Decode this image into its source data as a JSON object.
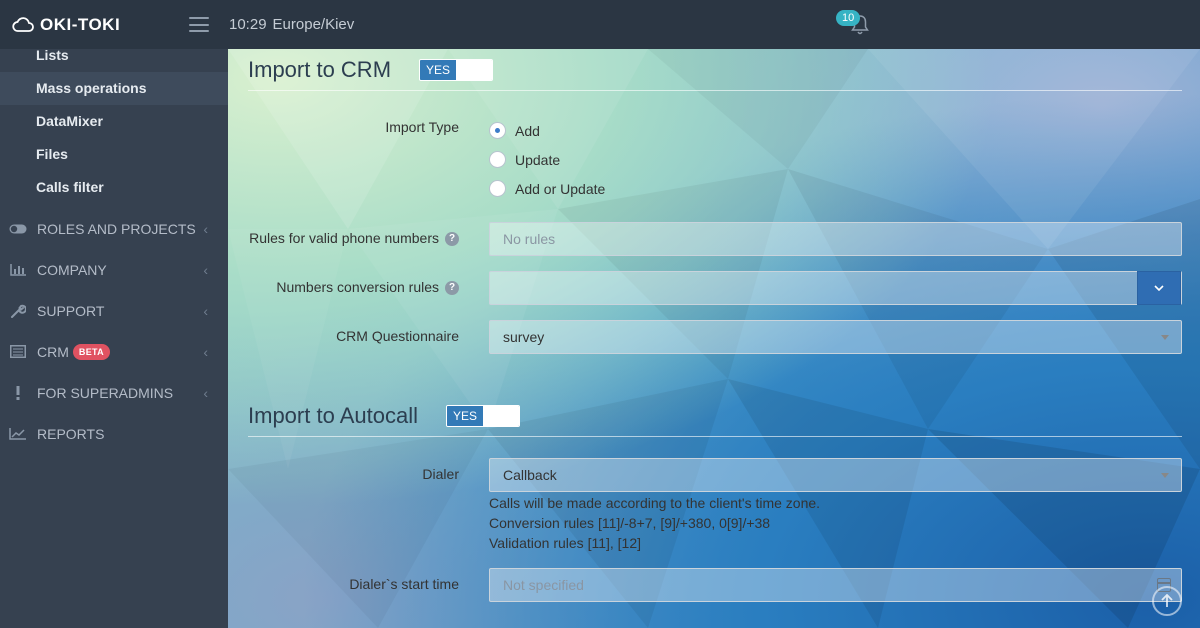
{
  "header": {
    "logo_text": "OKI-TOKI",
    "time": "10:29",
    "timezone": "Europe/Kiev",
    "notifications_count": "10"
  },
  "sidebar": {
    "sub_items": [
      {
        "label": "Lists"
      },
      {
        "label": "Mass operations"
      },
      {
        "label": "DataMixer"
      },
      {
        "label": "Files"
      },
      {
        "label": "Calls filter"
      }
    ],
    "nav_items": [
      {
        "label": "ROLES AND PROJECTS",
        "icon": "toggle-icon"
      },
      {
        "label": "COMPANY",
        "icon": "bar-chart-icon"
      },
      {
        "label": "SUPPORT",
        "icon": "wrench-icon"
      },
      {
        "label": "CRM",
        "icon": "list-icon",
        "badge": "BETA"
      },
      {
        "label": "FOR SUPERADMINS",
        "icon": "exclamation-icon"
      },
      {
        "label": "REPORTS",
        "icon": "line-chart-icon"
      }
    ]
  },
  "crm_section": {
    "title": "Import to CRM",
    "toggle_label": "YES",
    "import_type_label": "Import Type",
    "import_type_options": [
      "Add",
      "Update",
      "Add or Update"
    ],
    "rules_valid_label": "Rules for valid phone numbers",
    "rules_valid_placeholder": "No rules",
    "conversion_label": "Numbers conversion rules",
    "conversion_value": "",
    "questionnaire_label": "CRM Questionnaire",
    "questionnaire_value": "survey"
  },
  "autocall_section": {
    "title": "Import to Autocall",
    "toggle_label": "YES",
    "dialer_label": "Dialer",
    "dialer_value": "Callback",
    "info_lines": [
      "Calls will be made according to the client's time zone.",
      "Conversion rules [11]/-8+7, [9]/+380, 0[9]/+38",
      "Validation rules [11], [12]"
    ],
    "start_time_label": "Dialer`s start time",
    "start_time_placeholder": "Not specified"
  }
}
